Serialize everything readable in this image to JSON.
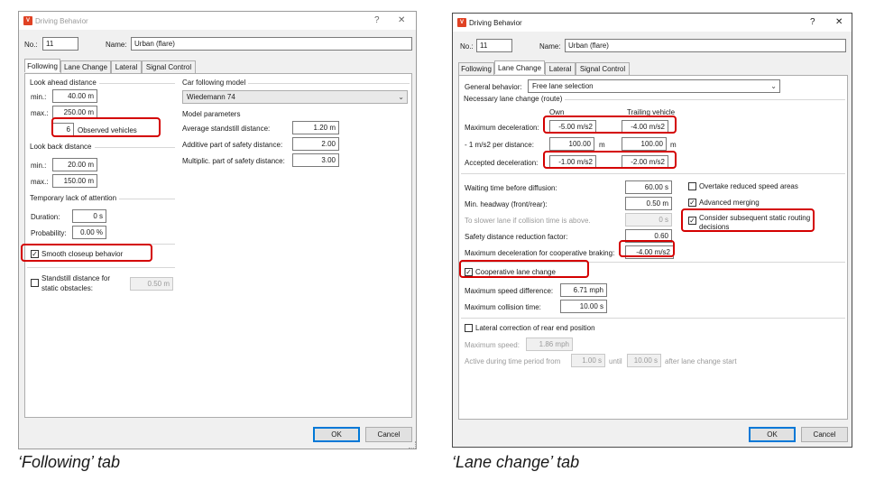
{
  "dialog_title": "Driving Behavior",
  "title_help": "?",
  "title_close": "✕",
  "app_icon_text": "V",
  "no_label": "No.:",
  "no_value": "11",
  "name_label": "Name:",
  "name_value": "Urban (flare)",
  "tabs": [
    "Following",
    "Lane Change",
    "Lateral",
    "Signal Control"
  ],
  "ok_label": "OK",
  "cancel_label": "Cancel",
  "left": {
    "caption": "‘Following’ tab",
    "look_ahead": {
      "title": "Look ahead distance",
      "min_label": "min.:",
      "min_value": "40.00 m",
      "max_label": "max.:",
      "max_value": "250.00 m",
      "observed_value": "6",
      "observed_label": "Observed vehicles"
    },
    "look_back": {
      "title": "Look back distance",
      "min_label": "min.:",
      "min_value": "20.00 m",
      "max_label": "max.:",
      "max_value": "150.00 m"
    },
    "attention": {
      "title": "Temporary lack of attention",
      "duration_label": "Duration:",
      "duration_value": "0 s",
      "probability_label": "Probability:",
      "probability_value": "0.00 %"
    },
    "smooth_closeup_label": "Smooth closeup behavior",
    "smooth_closeup_checked": true,
    "standstill_label_1": "Standstill distance for",
    "standstill_label_2": "static obstacles:",
    "standstill_checked": false,
    "standstill_value": "0.50 m",
    "car_following": {
      "title": "Car following model",
      "model": "Wiedemann 74",
      "params_title": "Model parameters",
      "avg_standstill_label": "Average standstill distance:",
      "avg_standstill_value": "1.20 m",
      "additive_label": "Additive part of safety distance:",
      "additive_value": "2.00",
      "multiplic_label": "Multiplic. part of safety distance:",
      "multiplic_value": "3.00"
    }
  },
  "right": {
    "caption": "‘Lane change’ tab",
    "general_behavior_label": "General behavior:",
    "general_behavior_value": "Free lane selection",
    "necessary_title": "Necessary lane change (route)",
    "own_header": "Own",
    "trailing_header": "Trailing vehicle",
    "max_decel_label": "Maximum deceleration:",
    "max_decel_own": "-5.00 m/s2",
    "max_decel_trailing": "-4.00 m/s2",
    "per_distance_label": "- 1 m/s2 per distance:",
    "per_distance_own": "100.00",
    "per_distance_trailing": "100.00",
    "m_unit": "m",
    "accepted_label": "Accepted deceleration:",
    "accepted_own": "-1.00 m/s2",
    "accepted_trailing": "-2.00 m/s2",
    "waiting_label": "Waiting time before diffusion:",
    "waiting_value": "60.00 s",
    "headway_label": "Min. headway (front/rear):",
    "headway_value": "0.50 m",
    "slower_lane_label": "To slower lane if collision time is above.",
    "slower_lane_value": "0 s",
    "safety_reduction_label": "Safety distance reduction factor:",
    "safety_reduction_value": "0.60",
    "coop_braking_label": "Maximum deceleration for cooperative braking:",
    "coop_braking_value": "-4.00 m/s2",
    "overtake_label": "Overtake reduced speed areas",
    "overtake_checked": false,
    "advanced_merging_label": "Advanced merging",
    "advanced_merging_checked": true,
    "consider_label_1": "Consider subsequent static routing",
    "consider_label_2": "decisions",
    "consider_checked": true,
    "coop_lane_change_label": "Cooperative lane change",
    "coop_lane_change_checked": true,
    "max_speed_diff_label": "Maximum speed difference:",
    "max_speed_diff_value": "6.71 mph",
    "max_collision_label": "Maximum collision time:",
    "max_collision_value": "10.00 s",
    "lateral_correction_label": "Lateral correction of rear end position",
    "lateral_correction_checked": false,
    "max_speed_label": "Maximum speed:",
    "max_speed_value": "1.86 mph",
    "active_label": "Active during time period from",
    "active_from": "1.00 s",
    "until_label": "until",
    "active_until": "10.00 s",
    "after_label": "after lane change start"
  },
  "colors": {
    "highlight": "#d40000",
    "app_icon": "#e04224",
    "default_button_border": "#0078d7"
  }
}
